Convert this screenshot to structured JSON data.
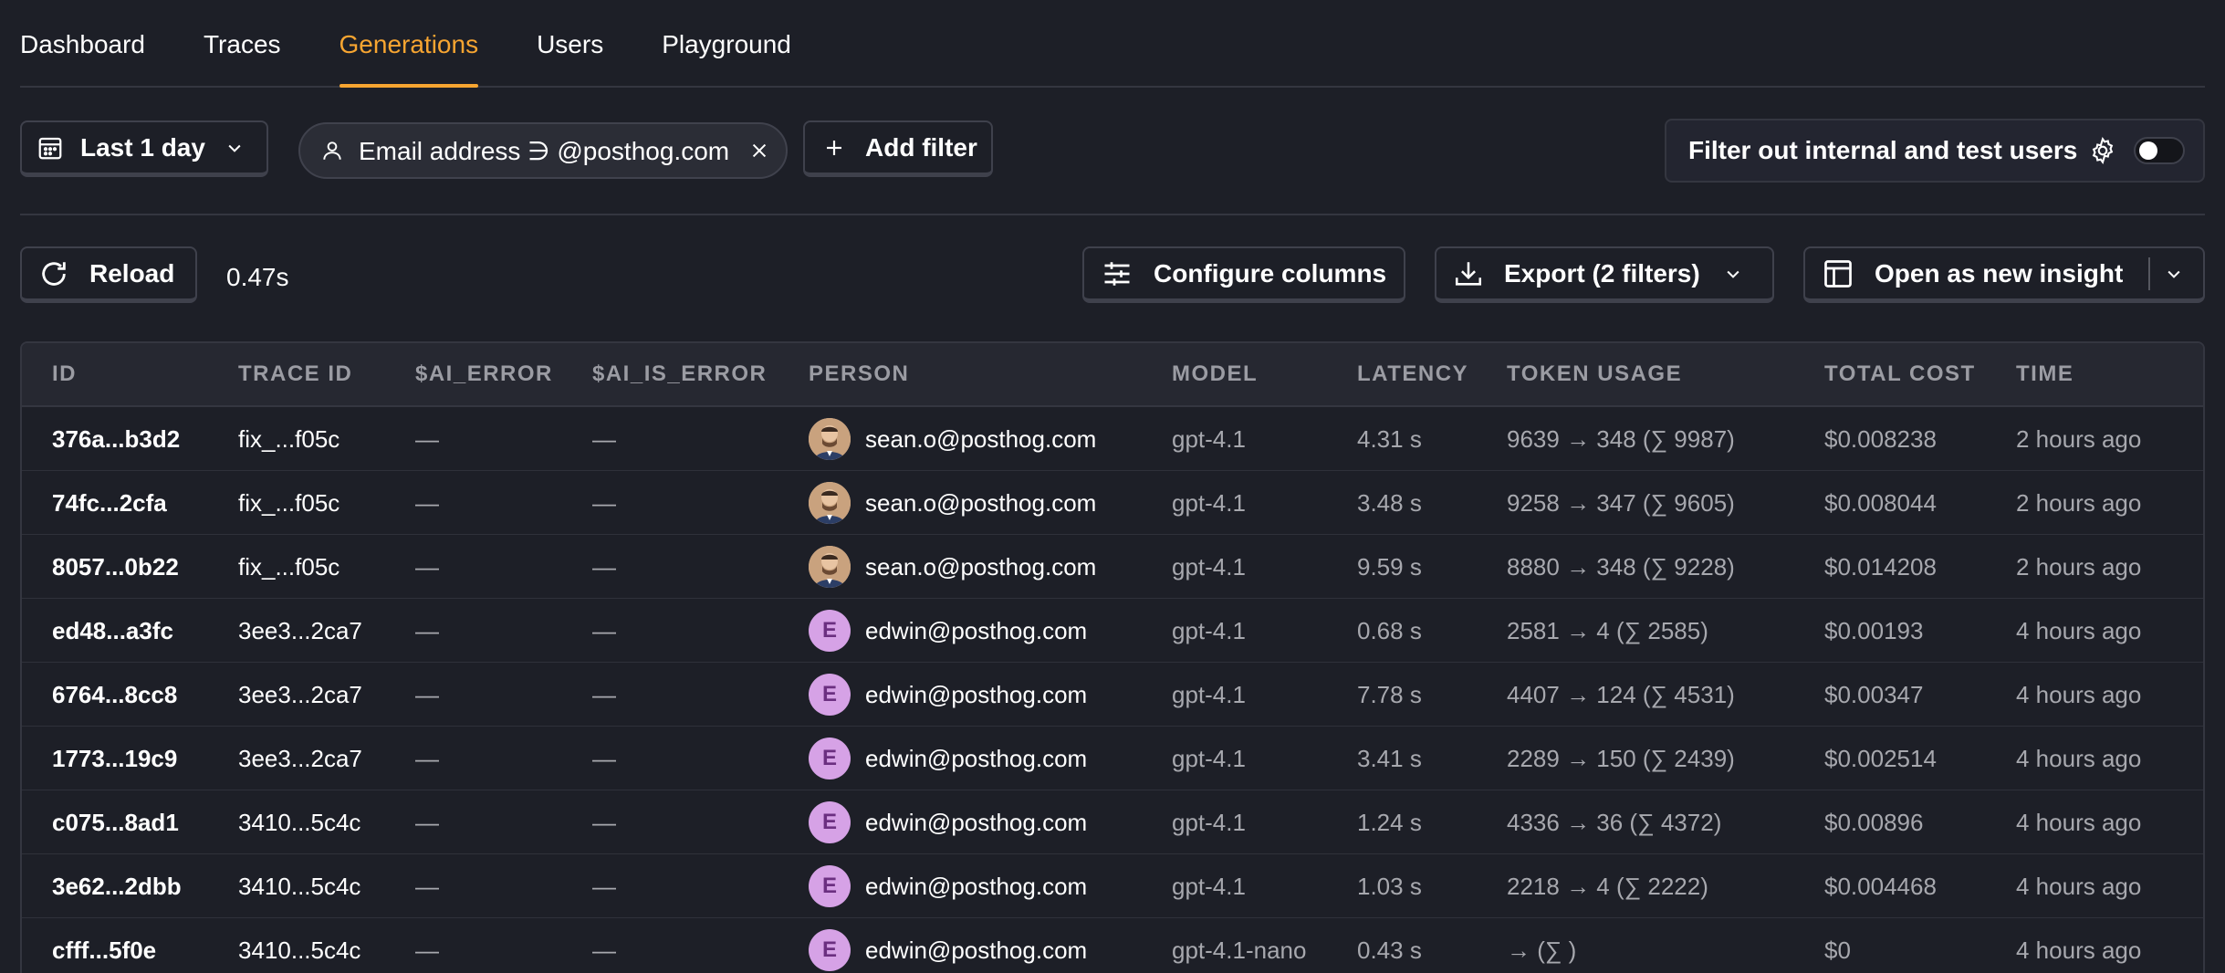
{
  "tabs": [
    {
      "label": "Dashboard",
      "active": false
    },
    {
      "label": "Traces",
      "active": false
    },
    {
      "label": "Generations",
      "active": true
    },
    {
      "label": "Users",
      "active": false
    },
    {
      "label": "Playground",
      "active": false
    }
  ],
  "filters": {
    "date_range": "Last 1 day",
    "chip": "Email address ∋ @posthog.com",
    "add_filter": "Add filter",
    "internal_label": "Filter out internal and test users",
    "internal_enabled": false
  },
  "toolbar": {
    "reload": "Reload",
    "elapsed": "0.47s",
    "configure": "Configure columns",
    "export": "Export (2 filters)",
    "insight": "Open as new insight"
  },
  "table": {
    "columns": [
      "ID",
      "TRACE ID",
      "$AI_ERROR",
      "$AI_IS_ERROR",
      "PERSON",
      "MODEL",
      "LATENCY",
      "TOKEN USAGE",
      "TOTAL COST",
      "TIME"
    ],
    "rows": [
      {
        "id": "376a...b3d2",
        "trace": "fix_...f05c",
        "err": "—",
        "iserr": "—",
        "avatar": "photo",
        "initial": "",
        "person": "sean.o@posthog.com",
        "model": "gpt-4.1",
        "latency": "4.31 s",
        "tokens": "9639 → 348 (∑ 9987)",
        "cost": "$0.008238",
        "time": "2 hours ago"
      },
      {
        "id": "74fc...2cfa",
        "trace": "fix_...f05c",
        "err": "—",
        "iserr": "—",
        "avatar": "photo",
        "initial": "",
        "person": "sean.o@posthog.com",
        "model": "gpt-4.1",
        "latency": "3.48 s",
        "tokens": "9258 → 347 (∑ 9605)",
        "cost": "$0.008044",
        "time": "2 hours ago"
      },
      {
        "id": "8057...0b22",
        "trace": "fix_...f05c",
        "err": "—",
        "iserr": "—",
        "avatar": "photo",
        "initial": "",
        "person": "sean.o@posthog.com",
        "model": "gpt-4.1",
        "latency": "9.59 s",
        "tokens": "8880 → 348 (∑ 9228)",
        "cost": "$0.014208",
        "time": "2 hours ago"
      },
      {
        "id": "ed48...a3fc",
        "trace": "3ee3...2ca7",
        "err": "—",
        "iserr": "—",
        "avatar": "letter",
        "initial": "E",
        "person": "edwin@posthog.com",
        "model": "gpt-4.1",
        "latency": "0.68 s",
        "tokens": "2581 → 4 (∑ 2585)",
        "cost": "$0.00193",
        "time": "4 hours ago"
      },
      {
        "id": "6764...8cc8",
        "trace": "3ee3...2ca7",
        "err": "—",
        "iserr": "—",
        "avatar": "letter",
        "initial": "E",
        "person": "edwin@posthog.com",
        "model": "gpt-4.1",
        "latency": "7.78 s",
        "tokens": "4407 → 124 (∑ 4531)",
        "cost": "$0.00347",
        "time": "4 hours ago"
      },
      {
        "id": "1773...19c9",
        "trace": "3ee3...2ca7",
        "err": "—",
        "iserr": "—",
        "avatar": "letter",
        "initial": "E",
        "person": "edwin@posthog.com",
        "model": "gpt-4.1",
        "latency": "3.41 s",
        "tokens": "2289 → 150 (∑ 2439)",
        "cost": "$0.002514",
        "time": "4 hours ago"
      },
      {
        "id": "c075...8ad1",
        "trace": "3410...5c4c",
        "err": "—",
        "iserr": "—",
        "avatar": "letter",
        "initial": "E",
        "person": "edwin@posthog.com",
        "model": "gpt-4.1",
        "latency": "1.24 s",
        "tokens": "4336 → 36 (∑ 4372)",
        "cost": "$0.00896",
        "time": "4 hours ago"
      },
      {
        "id": "3e62...2dbb",
        "trace": "3410...5c4c",
        "err": "—",
        "iserr": "—",
        "avatar": "letter",
        "initial": "E",
        "person": "edwin@posthog.com",
        "model": "gpt-4.1",
        "latency": "1.03 s",
        "tokens": "2218 → 4 (∑ 2222)",
        "cost": "$0.004468",
        "time": "4 hours ago"
      },
      {
        "id": "cfff...5f0e",
        "trace": "3410...5c4c",
        "err": "—",
        "iserr": "—",
        "avatar": "letter",
        "initial": "E",
        "person": "edwin@posthog.com",
        "model": "gpt-4.1-nano",
        "latency": "0.43 s",
        "tokens": "→ (∑ )",
        "cost": "$0",
        "time": "4 hours ago"
      }
    ]
  },
  "colors": {
    "background": "#1d1f27",
    "accent": "#f7a531",
    "avatar_letter_bg": "#d6a2e6"
  }
}
